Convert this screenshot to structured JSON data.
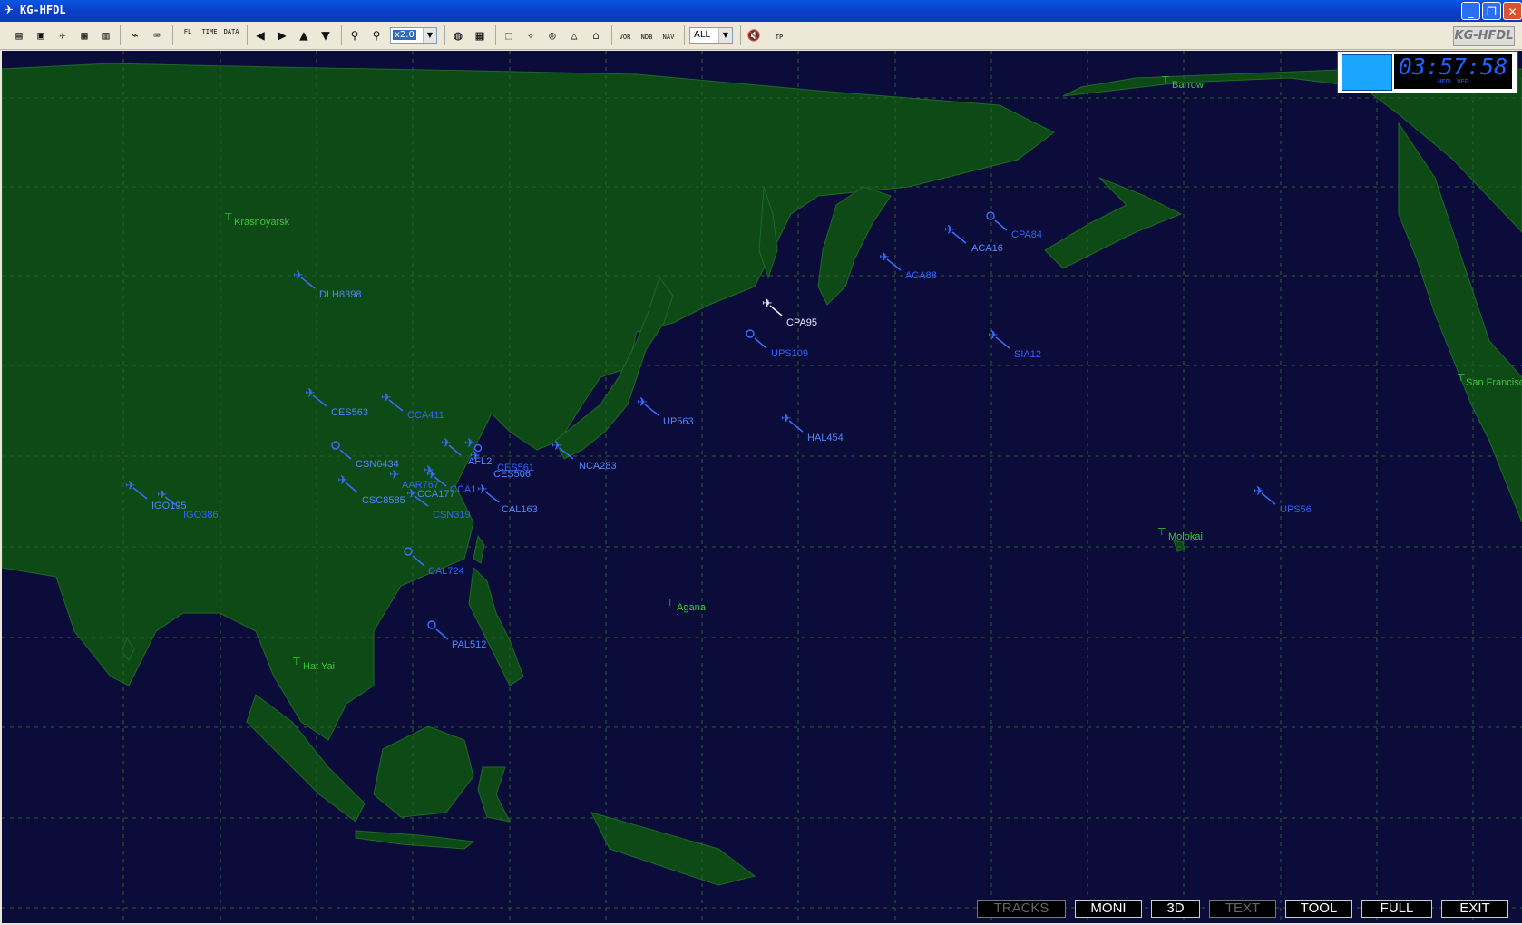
{
  "window": {
    "title": "KG-HFDL",
    "minimize": "_",
    "restore": "❐",
    "close": "✕"
  },
  "toolbar": {
    "zoom_value": "x2.0",
    "filter_value": "ALL",
    "labels": {
      "fl": "FL",
      "time": "TIME",
      "data": "DATA",
      "vor": "VOR",
      "ndb": "NDB",
      "nav": "NAV",
      "tp": "TP"
    },
    "brand": "KG-HFDL"
  },
  "clock": {
    "time": "03:57:58",
    "caption": "HFDL OFF"
  },
  "places": [
    "Krasnoyarsk",
    "Barrow",
    "San Francisco",
    "Molokai",
    "Agana",
    "Hat Yai"
  ],
  "flights": [
    "DLH8398",
    "CES563",
    "CCA411",
    "CSN6434",
    "AAR767",
    "CCA177",
    "CSC8585",
    "CSN319",
    "IGO195",
    "IGO386",
    "AFL2",
    "CES561",
    "CES506",
    "CCA1",
    "CAL163",
    "NCA283",
    "UP563",
    "UPS109",
    "CPA95",
    "HAL454",
    "ACA88",
    "ACA16",
    "CPA84",
    "SIA12",
    "UPS56",
    "CAL724",
    "PAL512"
  ],
  "bottom_buttons": [
    "TRACKS",
    "MONI",
    "3D",
    "TEXT",
    "TOOL",
    "FULL",
    "EXIT"
  ],
  "colors": {
    "ocean": "#0b0c3a",
    "land": "#0e4a16",
    "grid": "#2f5f2f",
    "aircraft": "#3a6dff",
    "place": "#38c838"
  }
}
